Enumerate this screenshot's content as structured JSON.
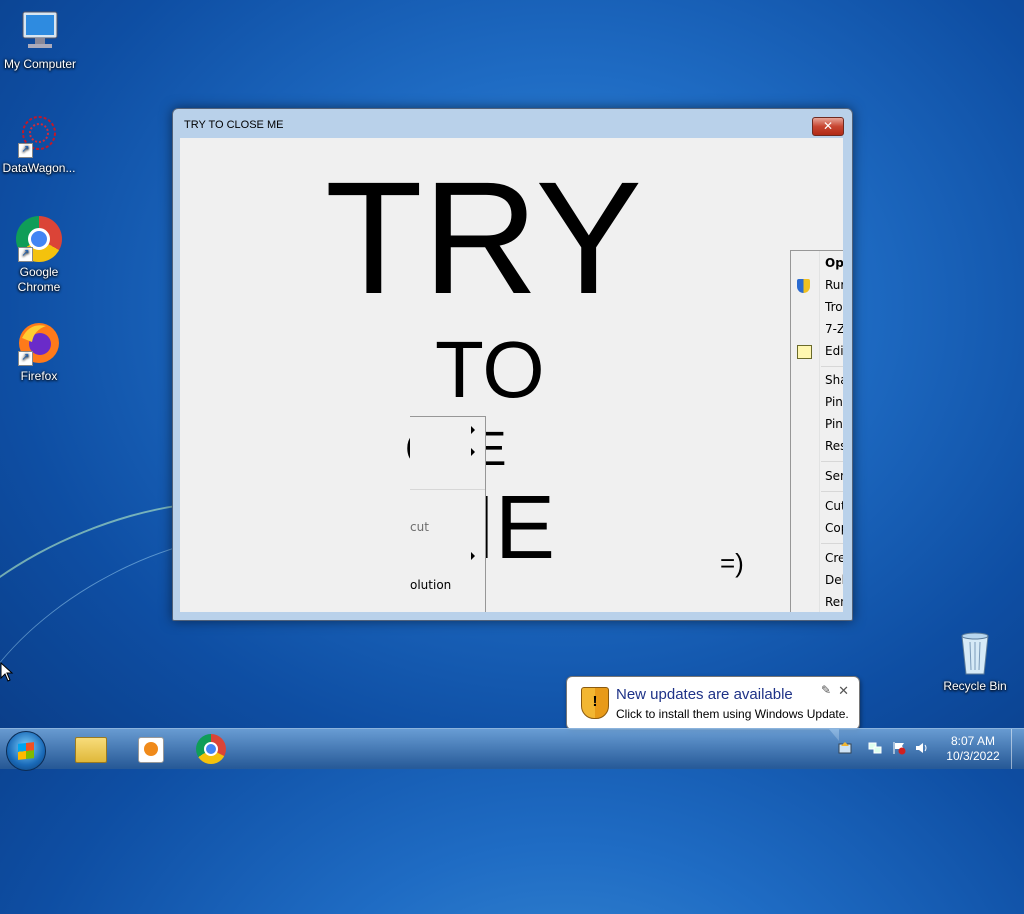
{
  "desktop": {
    "icons": [
      {
        "label": "My Computer",
        "icon": "computer-icon"
      },
      {
        "label": "DataWagon...",
        "icon": "datawagon-icon"
      },
      {
        "label": "Google Chrome",
        "icon": "chrome-icon"
      },
      {
        "label": "Firefox",
        "icon": "firefox-icon"
      },
      {
        "label": "Recycle Bin",
        "icon": "recycle-bin-icon"
      }
    ]
  },
  "window": {
    "title": "TRY TO CLOSE ME",
    "close_glyph": "✕",
    "lines": [
      "TRY",
      "TO",
      "OSE",
      "ME"
    ],
    "smiley": "=)"
  },
  "context_menu_left": {
    "items": [
      "cut",
      "olution"
    ]
  },
  "context_menu_right": {
    "items": [
      "Ope",
      "Rur",
      "Tro",
      "7-Z",
      "Edit",
      "Sha",
      "Pin",
      "Pin",
      "Res",
      "Sen",
      "Cut",
      "Cop",
      "Cre",
      "Dele",
      "Ren"
    ]
  },
  "notification": {
    "title": "New updates are available",
    "text": "Click to install them using Windows Update.",
    "close": "✕",
    "options": "✎"
  },
  "taskbar": {
    "time": "8:07 AM",
    "date": "10/3/2022",
    "apps": [
      "explorer-icon",
      "media-player-icon",
      "chrome-icon"
    ],
    "tray": [
      "network-icon",
      "action-center-flag-icon",
      "volume-icon",
      "windows-update-icon"
    ]
  },
  "colors": {
    "accent": "#1f6cc4",
    "close_button": "#c74531"
  }
}
